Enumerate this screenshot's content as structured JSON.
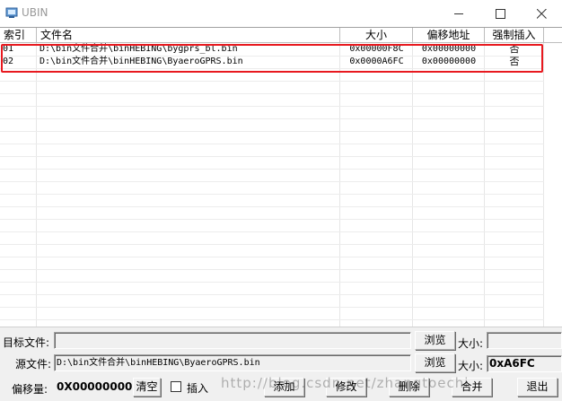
{
  "window": {
    "title": "UBIN"
  },
  "list": {
    "columns": [
      "索引",
      "文件名",
      "大小",
      "偏移地址",
      "强制插入"
    ],
    "rows": [
      {
        "index": "01",
        "filename": "D:\\bin文件合并\\binHEBING\\bygprs_bl.bin",
        "size": "0x00000F8C",
        "offset": "0x00000000",
        "force": "否"
      },
      {
        "index": "02",
        "filename": "D:\\bin文件合并\\binHEBING\\ByaeroGPRS.bin",
        "size": "0x0000A6FC",
        "offset": "0x00000000",
        "force": "否"
      }
    ]
  },
  "form": {
    "target_label": "目标文件:",
    "target_value": "",
    "browse_label": "浏览",
    "size_label": "大小:",
    "target_size": "",
    "source_label": "源文件:",
    "source_value": "D:\\bin文件合并\\binHEBING\\ByaeroGPRS.bin",
    "source_size": "0xA6FC",
    "offset_label": "偏移量:",
    "offset_value": "0X00000000",
    "clear_label": "清空",
    "insert_label": "插入",
    "insert_checked": false
  },
  "actions": {
    "add": "添加",
    "modify": "修改",
    "delete": "删除",
    "merge": "合并",
    "exit": "退出"
  },
  "watermark": "http://blog.csdn.net/zhangtoechi",
  "colors": {
    "highlight": "#e8191f"
  }
}
